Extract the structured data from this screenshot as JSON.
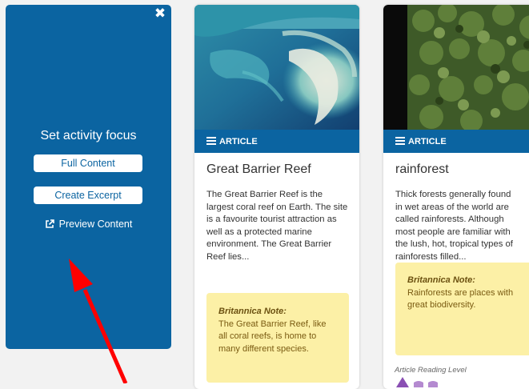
{
  "focus_panel": {
    "title": "Set activity focus",
    "full_content_label": "Full Content",
    "create_excerpt_label": "Create Excerpt",
    "preview_content_label": "Preview Content",
    "close_icon": "close-icon",
    "preview_icon": "external-link-icon"
  },
  "cards": [
    {
      "type_label": "ARTICLE",
      "image": "aerial-coral-reef-photo",
      "title": "Great Barrier Reef",
      "summary": "The Great Barrier Reef is the largest coral reef on Earth. The site is a favourite tourist attraction as well as a protected marine environment. The Great Barrier Reef lies...",
      "note_title": "Britannica Note:",
      "note_text": "The Great Barrier Reef, like all coral reefs, is home to many different species."
    },
    {
      "type_label": "ARTICLE",
      "image": "rainforest-canopy-photo",
      "title": "rainforest",
      "summary": "Thick forests generally found\nin wet areas of the world are\ncalled rainforests. Although\nmost people are familiar with\nthe lush, hot, tropical types of\nrainforests filled...",
      "note_title": "Britannica Note:",
      "note_text": "Rainforests are places with great biodiversity.",
      "reading_level_label": "Article Reading Level"
    }
  ],
  "colors": {
    "panel_blue": "#0b64a1",
    "note_yellow": "#fcf0a6",
    "annotation_arrow": "#ff0000"
  }
}
